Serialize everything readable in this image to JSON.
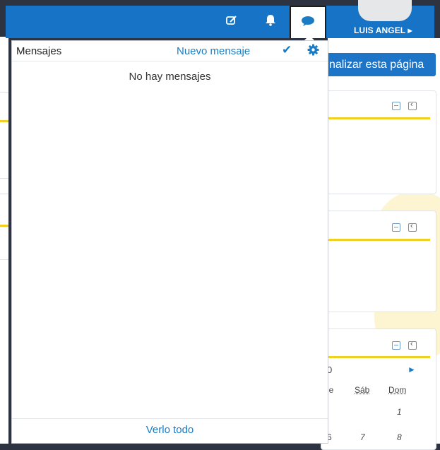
{
  "navbar": {
    "icons": [
      "edit-icon",
      "bell-icon",
      "chat-icon"
    ],
    "user_name": "LUIS ANGEL ▸"
  },
  "page": {
    "customize_label": "nalizar esta página",
    "calendar": {
      "month_fragment": "0",
      "next_arrow": "►",
      "day_headers": [
        "ie",
        "Sáb",
        "Dom"
      ],
      "row1": [
        "",
        "",
        "1"
      ],
      "row2": [
        "6",
        "7",
        "8"
      ]
    }
  },
  "messages_popover": {
    "title": "Mensajes",
    "new_message": "Nuevo mensaje",
    "empty_text": "No hay mensajes",
    "see_all": "Verlo todo"
  },
  "colors": {
    "brand": "#1773c6",
    "accent_yellow": "#f2d021",
    "link": "#1a7cc4"
  }
}
